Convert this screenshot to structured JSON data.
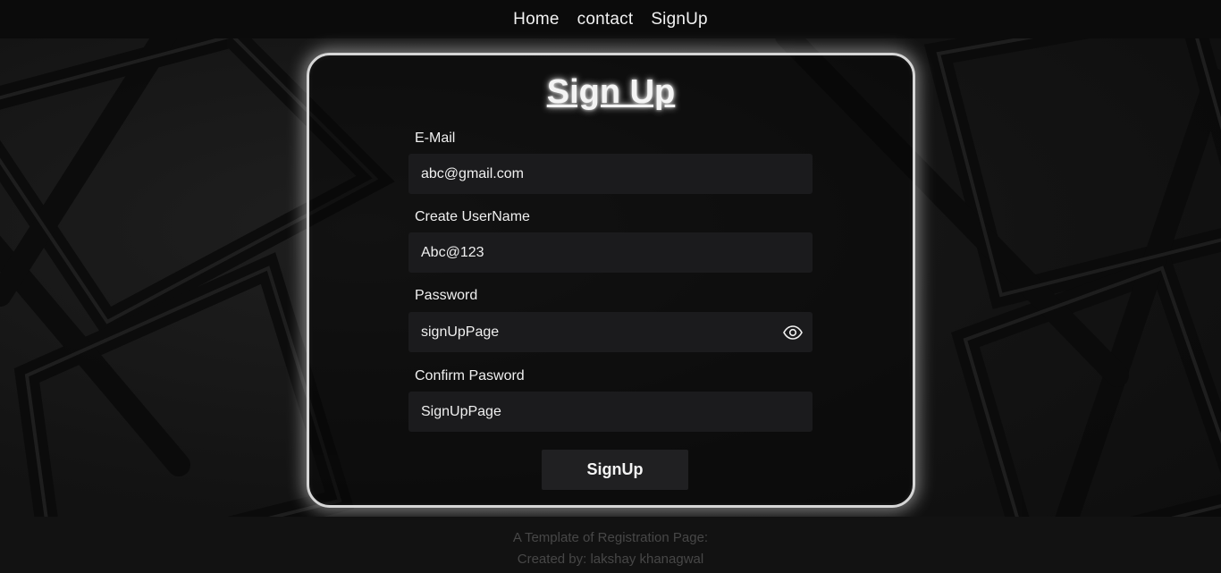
{
  "nav": {
    "items": [
      {
        "label": "Home"
      },
      {
        "label": "contact"
      },
      {
        "label": "SignUp"
      }
    ]
  },
  "form": {
    "title": "Sign Up",
    "email": {
      "label": "E-Mail",
      "value": "abc@gmail.com"
    },
    "username": {
      "label": "Create UserName",
      "value": "Abc@123"
    },
    "password": {
      "label": "Password",
      "value": "signUpPage"
    },
    "confirm_password": {
      "label": "Confirm Pasword",
      "value": "SignUpPage"
    },
    "submit_label": "SignUp"
  },
  "footer": {
    "line1": "A Template of Registration Page:",
    "line2": "Created by: lakshay khanagwal"
  },
  "colors": {
    "background": "#161616",
    "navbar": "#0b0b0b",
    "card_border": "#d6d6d6",
    "input_bg": "#1b1b1d",
    "button_bg": "#202022",
    "footer_text": "#474747"
  },
  "icons": {
    "password_toggle": "eye-icon"
  }
}
